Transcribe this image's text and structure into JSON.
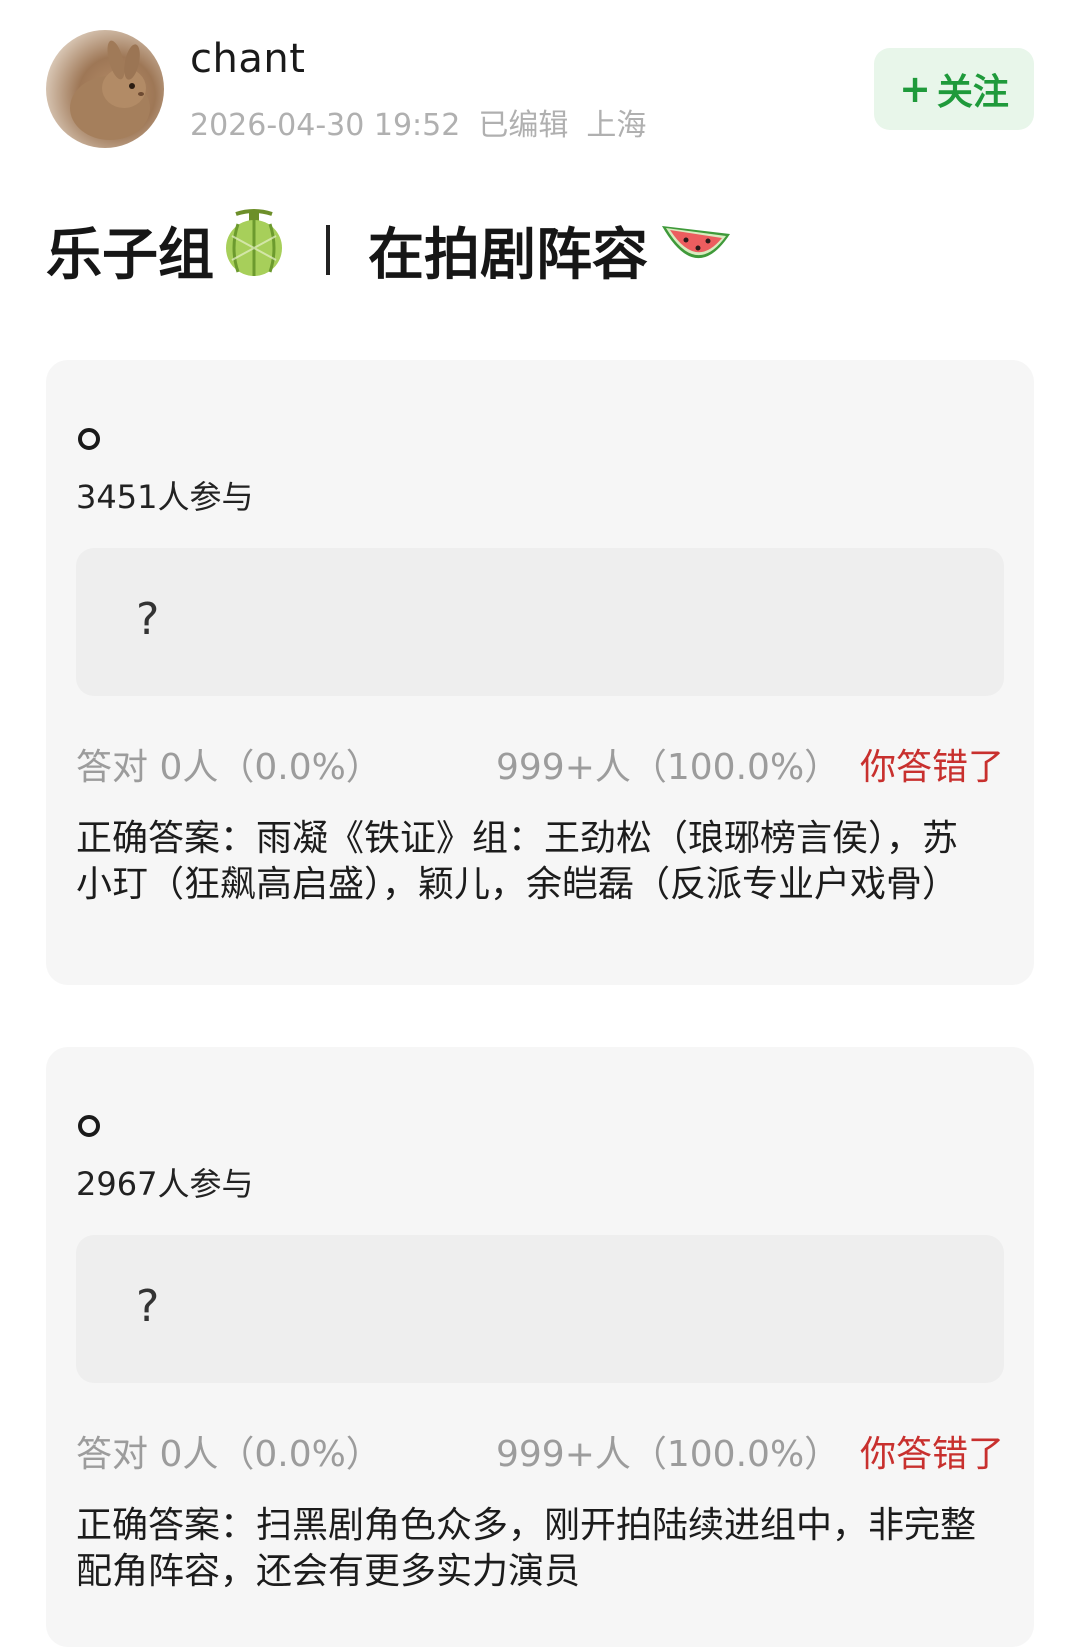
{
  "post": {
    "username": "chant",
    "timestamp": "2026-04-30 19:52",
    "edited": "已编辑",
    "location": "上海",
    "follow_label": "关注",
    "follow_plus": "+",
    "title_left": "乐子组",
    "title_right": "在拍剧阵容"
  },
  "quizzes": [
    {
      "participants": "3451人参与",
      "answer_placeholder": "?",
      "correct_stat": "答对  0人（0.0%）",
      "wrong_stat": "999+人（100.0%）",
      "verdict": "你答错了",
      "explanation": "正确答案：雨凝《铁证》组：王劲松（琅琊榜言侯），苏小玎（狂飙高启盛），颖儿，余皑磊（反派专业户戏骨）"
    },
    {
      "participants": "2967人参与",
      "answer_placeholder": "?",
      "correct_stat": "答对  0人（0.0%）",
      "wrong_stat": "999+人（100.0%）",
      "verdict": "你答错了",
      "explanation": "正确答案：扫黑剧角色众多，刚开拍陆续进组中，非完整配角阵容，还会有更多实力演员"
    }
  ],
  "icons": {
    "avatar": "rabbit-avatar",
    "title_emoji_1": "melon-icon",
    "title_emoji_2": "watermelon-icon"
  },
  "colors": {
    "follow_text": "#1f9a3b",
    "follow_bg": "#e8f6ea",
    "verdict": "#c8302e",
    "card_bg": "#f6f6f6"
  }
}
